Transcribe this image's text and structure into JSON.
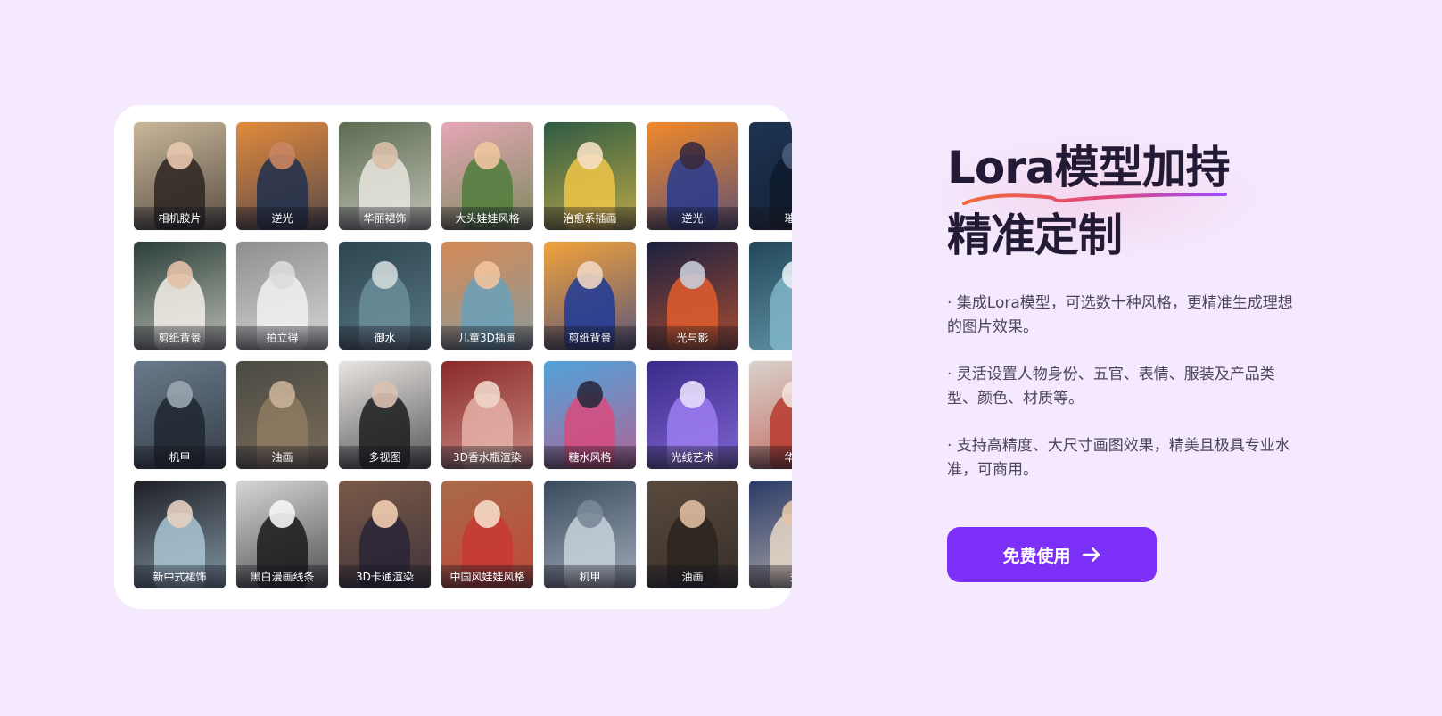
{
  "gallery": {
    "tiles": [
      {
        "label": "相机胶片",
        "bg": "#c9b79a",
        "accent": "#2b2420",
        "skin": "#e8c8b0"
      },
      {
        "label": "逆光",
        "bg": "#e28a3c",
        "accent": "#1f2f4e",
        "skin": "#c98560"
      },
      {
        "label": "华丽裙饰",
        "bg": "#5c6b52",
        "accent": "#e9e6df",
        "skin": "#d9bfa8"
      },
      {
        "label": "大头娃娃风格",
        "bg": "#e7a7b6",
        "accent": "#4f7d3b",
        "skin": "#f1c5a1"
      },
      {
        "label": "治愈系插画",
        "bg": "#2f5b43",
        "accent": "#f0c548",
        "skin": "#f4dfc2"
      },
      {
        "label": "逆光",
        "bg": "#f08a2a",
        "accent": "#283a8e",
        "skin": "#3a2a3c"
      },
      {
        "label": "璀璨",
        "bg": "#1d3350",
        "accent": "#0f1a2c",
        "skin": "#4a5c7a"
      },
      {
        "label": "剪纸背景",
        "bg": "#2a3e36",
        "accent": "#f3efe8",
        "skin": "#e3c1a8"
      },
      {
        "label": "拍立得",
        "bg": "#8e8e8e",
        "accent": "#f2f2f2",
        "skin": "#dcdcdc"
      },
      {
        "label": "御水",
        "bg": "#2d4550",
        "accent": "#6b8d9a",
        "skin": "#cfd8da"
      },
      {
        "label": "儿童3D插画",
        "bg": "#d58a56",
        "accent": "#6aa1b8",
        "skin": "#f2c39c"
      },
      {
        "label": "剪纸背景",
        "bg": "#f2a23a",
        "accent": "#1f3a96",
        "skin": "#f1d5c0"
      },
      {
        "label": "光与影",
        "bg": "#1a2140",
        "accent": "#e05d2d",
        "skin": "#c8cbd8"
      },
      {
        "label": "",
        "bg": "#22485a",
        "accent": "#7fb6c8",
        "skin": "#e5eef2"
      },
      {
        "label": "机甲",
        "bg": "#6a7a8a",
        "accent": "#1f262e",
        "skin": "#9aa6b0"
      },
      {
        "label": "油画",
        "bg": "#4a4a44",
        "accent": "#8e7a62",
        "skin": "#c6b098"
      },
      {
        "label": "多视图",
        "bg": "#e8e5e2",
        "accent": "#1d1d1f",
        "skin": "#d9c1b1"
      },
      {
        "label": "3D香水瓶渲染",
        "bg": "#8a2a2a",
        "accent": "#e6b2a8",
        "skin": "#f0d5c8"
      },
      {
        "label": "糖水风格",
        "bg": "#4fa3d9",
        "accent": "#d84b7c",
        "skin": "#2a2a40"
      },
      {
        "label": "光线艺术",
        "bg": "#3a2a8a",
        "accent": "#9b7cf0",
        "skin": "#e5defa"
      },
      {
        "label": "华丽",
        "bg": "#d9d2cc",
        "accent": "#b83a2e",
        "skin": "#f1e3da"
      },
      {
        "label": "新中式裙饰",
        "bg": "#1e1e24",
        "accent": "#a9c6d6",
        "skin": "#e6cfc2"
      },
      {
        "label": "黑白漫画线条",
        "bg": "#d6d6d6",
        "accent": "#1a1a1a",
        "skin": "#f5f5f5"
      },
      {
        "label": "3D卡通渲染",
        "bg": "#7a5a48",
        "accent": "#2a2436",
        "skin": "#f2cdb0"
      },
      {
        "label": "中国风娃娃风格",
        "bg": "#a86a4a",
        "accent": "#c83a32",
        "skin": "#f5dcc8"
      },
      {
        "label": "机甲",
        "bg": "#3a4a5e",
        "accent": "#c9d2dc",
        "skin": "#7a8899"
      },
      {
        "label": "油画",
        "bg": "#5a4a3e",
        "accent": "#2a2420",
        "skin": "#e0bca0"
      },
      {
        "label": "多",
        "bg": "#2a3a66",
        "accent": "#e8d8c8",
        "skin": "#e6c4a8"
      }
    ]
  },
  "headline": {
    "line1": "Lora模型加持",
    "line2": "精准定制"
  },
  "bullets": [
    "· 集成Lora模型，可选数十种风格，更精准生成理想的图片效果。",
    "· 灵活设置人物身份、五官、表情、服装及产品类型、颜色、材质等。",
    "· 支持高精度、大尺寸画图效果，精美且极具专业水准，可商用。"
  ],
  "cta": {
    "label": "免费使用",
    "icon": "arrow-right-icon",
    "color": "#7b2ff7"
  },
  "colors": {
    "page_bg": "#f4e9fd",
    "headline_text": "#231a35",
    "underline_start": "#f06a3a",
    "underline_end": "#9b4dff"
  }
}
